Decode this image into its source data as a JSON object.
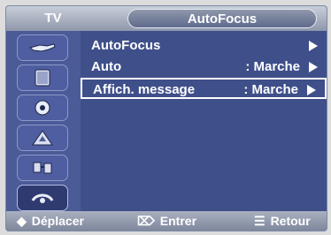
{
  "header": {
    "tv_label": "TV",
    "title": "AutoFocus"
  },
  "menu": {
    "items": [
      {
        "label": "AutoFocus",
        "value": "",
        "selected": false
      },
      {
        "label": "Auto",
        "value": ": Marche",
        "selected": false
      },
      {
        "label": "Affich. message",
        "value": ": Marche",
        "selected": true
      }
    ]
  },
  "sidebar": {
    "icons": [
      "picture-icon",
      "sound-icon",
      "channel-icon",
      "setup-icon",
      "input-icon",
      "function-icon"
    ]
  },
  "footer": {
    "move_icon": "◆",
    "move_label": "Déplacer",
    "enter_icon": "⌦",
    "enter_label": "Entrer",
    "return_icon": "☰",
    "return_label": "Retour"
  },
  "colors": {
    "menu_bg": "#3f4f8a",
    "sidebar_bg": "#4a5b97",
    "highlight_border": "#ffffff"
  }
}
